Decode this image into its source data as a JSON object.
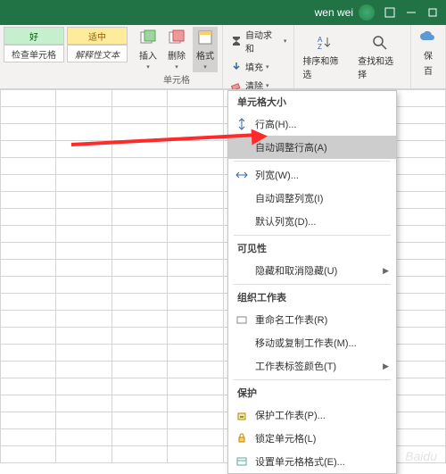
{
  "titlebar": {
    "user": "wen wei"
  },
  "ribbon": {
    "styles": {
      "good": "好",
      "neutral": "适中",
      "check": "检查单元格",
      "explain": "解释性文本"
    },
    "cells": {
      "insert": "插入",
      "delete": "删除",
      "format": "格式",
      "groupLabel": "单元格"
    },
    "editing": {
      "autosum": "自动求和",
      "fill": "填充",
      "clear": "清除"
    },
    "sortFilter": "排序和筛选",
    "findSelect": "查找和选择",
    "save": "保",
    "baidu": "百"
  },
  "menu": {
    "sectionSize": "单元格大小",
    "rowHeight": "行高(H)...",
    "autoRowHeight": "自动调整行高(A)",
    "colWidth": "列宽(W)...",
    "autoColWidth": "自动调整列宽(I)",
    "defaultWidth": "默认列宽(D)...",
    "sectionVisibility": "可见性",
    "hideUnhide": "隐藏和取消隐藏(U)",
    "sectionOrganize": "组织工作表",
    "rename": "重命名工作表(R)",
    "move": "移动或复制工作表(M)...",
    "tabColor": "工作表标签颜色(T)",
    "sectionProtect": "保护",
    "protectSheet": "保护工作表(P)...",
    "lockCell": "锁定单元格(L)",
    "formatCells": "设置单元格格式(E)..."
  },
  "watermark": "Baidu"
}
